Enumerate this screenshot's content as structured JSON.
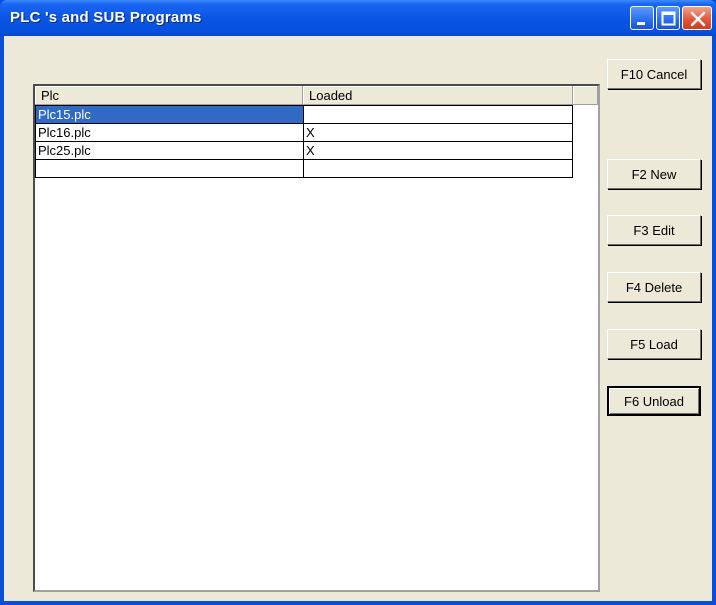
{
  "window": {
    "title": "PLC 's and SUB Programs"
  },
  "list": {
    "columns": [
      "Plc",
      "Loaded"
    ],
    "rows": [
      {
        "plc": "Plc15.plc",
        "loaded": ""
      },
      {
        "plc": "Plc16.plc",
        "loaded": "X"
      },
      {
        "plc": "Plc25.plc",
        "loaded": "X"
      },
      {
        "plc": "",
        "loaded": ""
      }
    ],
    "selected_row": 0
  },
  "buttons": {
    "cancel": "F10 Cancel",
    "new": "F2 New",
    "edit": "F3 Edit",
    "delete": "F4 Delete",
    "load": "F5 Load",
    "unload": "F6 Unload"
  },
  "colors": {
    "titlebar": "#0a56e4",
    "selection": "#316ac5",
    "face": "#ece9d8"
  }
}
